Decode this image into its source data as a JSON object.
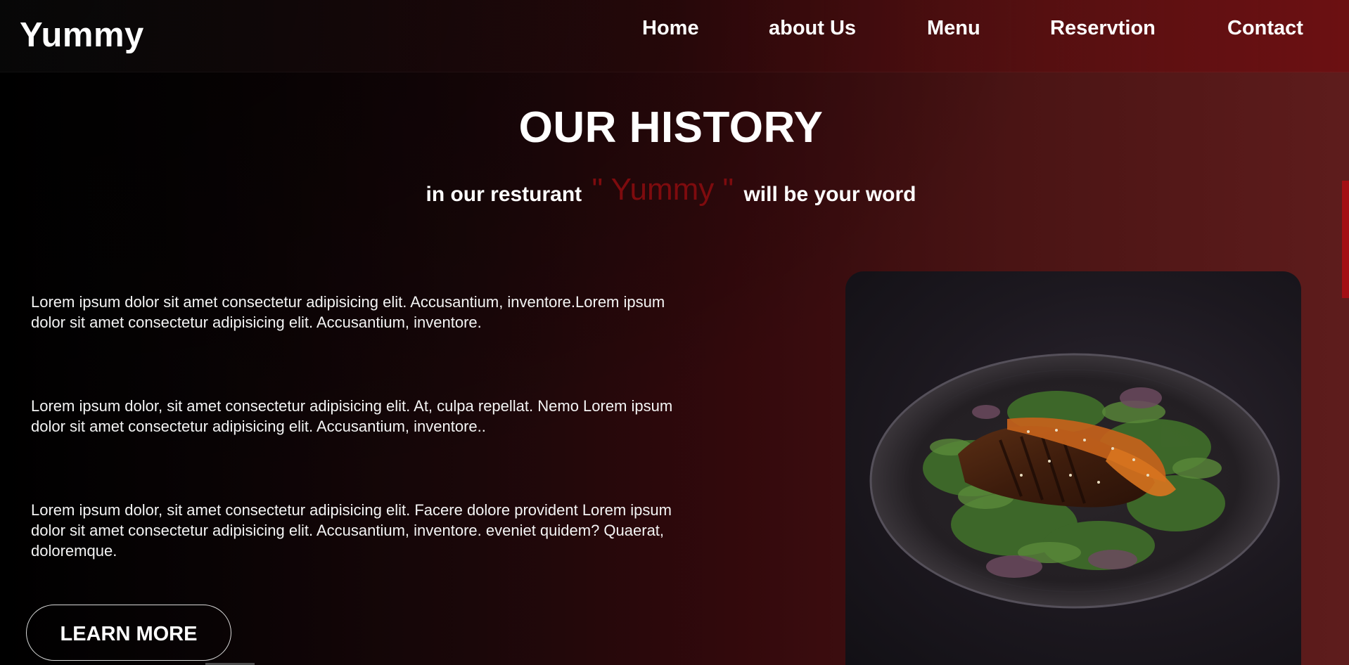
{
  "header": {
    "logo": "Yummy",
    "nav": [
      {
        "label": "Home"
      },
      {
        "label": "about Us"
      },
      {
        "label": "Menu"
      },
      {
        "label": "Reservtion"
      },
      {
        "label": "Contact"
      }
    ]
  },
  "history": {
    "title": "OUR HISTORY",
    "subtitle_prefix": "in our resturant",
    "subtitle_brand": "\" Yummy \"",
    "subtitle_suffix": "will be your word",
    "paragraphs": [
      "Lorem ipsum dolor sit amet consectetur adipisicing elit. Accusantium, inventore.Lorem ipsum dolor sit amet consectetur adipisicing elit. Accusantium, inventore.",
      "Lorem ipsum dolor, sit amet consectetur adipisicing elit. At, culpa repellat. Nemo Lorem ipsum dolor sit amet consectetur adipisicing elit. Accusantium, inventore..",
      "Lorem ipsum dolor, sit amet consectetur adipisicing elit. Facere dolore provident Lorem ipsum dolor sit amet consectetur adipisicing elit. Accusantium, inventore. eveniet quidem? Quaerat, doloremque."
    ],
    "button_label": "LEARN MORE"
  },
  "colors": {
    "brand_accent": "#7e0b0e",
    "scroll_thumb": "#a30f14"
  },
  "image": {
    "icon": "grilled-chicken-salad-plate-image"
  }
}
